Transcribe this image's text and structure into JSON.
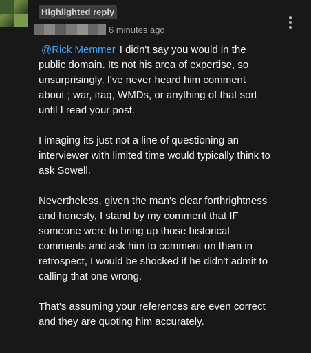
{
  "header": {
    "badge": "Highlighted reply",
    "timestamp": "6 minutes ago"
  },
  "icons": {
    "menu": "more-vert-icon",
    "avatar": "user-avatar"
  },
  "colors": {
    "background": "#181818",
    "text": "#f1f1f1",
    "mention": "#3ea6ff",
    "meta": "#aaaaaa"
  },
  "comment": {
    "mention": "@Rick Memmer",
    "paragraph1_text": "I didn't say you would in the public domain. Its not his area of expertise, so unsurprisingly, I've never heard him comment about ; war, iraq, WMDs, or anything of that sort until I read your post.",
    "paragraph2": "I imaging its just not a line of questioning an interviewer with limited time would typically think to ask Sowell.",
    "paragraph3": "Nevertheless, given the man's clear forthrightness and honesty, I stand by my comment that IF someone were to bring up those historical comments and ask him to comment on them in retrospect, I would be shocked if he didn't admit to calling that one wrong.",
    "paragraph4": "That's assuming your references are even correct and they are quoting him accurately."
  }
}
